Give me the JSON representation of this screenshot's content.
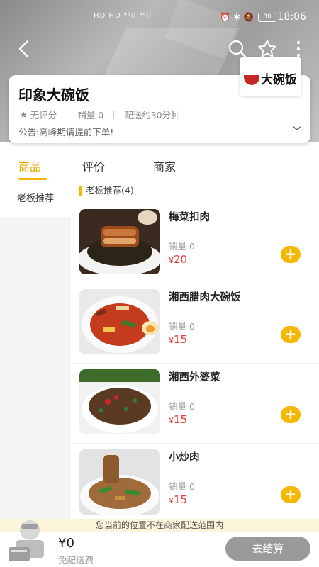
{
  "status_bar": {
    "battery": "80",
    "time": "18:06",
    "network_left": "HD HD ⁴⁶ıl ⁴⁶ıl",
    "icons_right": "⏰ ✱ 🔕"
  },
  "store": {
    "name": "印象大碗饭",
    "rating_text": "无评分",
    "sales_text": "销量 0",
    "delivery_text": "配送约30分钟",
    "notice": "公告:高峰期请提前下单!",
    "logo_text": "大碗饭"
  },
  "tabs": [
    {
      "label": "商品",
      "active": true
    },
    {
      "label": "评价",
      "active": false
    },
    {
      "label": "商家",
      "active": false
    }
  ],
  "sidebar": {
    "items": [
      {
        "label": "老板推荐"
      }
    ]
  },
  "section_title": "老板推荐(4)",
  "products": [
    {
      "name": "梅菜扣肉",
      "sales": "销量 0",
      "currency": "¥",
      "price": "20"
    },
    {
      "name": "湘西腊肉大碗饭",
      "sales": "销量 0",
      "currency": "¥",
      "price": "15"
    },
    {
      "name": "湘西外婆菜",
      "sales": "销量 0",
      "currency": "¥",
      "price": "15"
    },
    {
      "name": "小炒肉",
      "sales": "销量 0",
      "currency": "¥",
      "price": "15"
    }
  ],
  "add_label": "+",
  "cart": {
    "out_of_range_notice": "您当前的位置不在商家配送范围内",
    "total": "¥0",
    "delivery_fee": "免配送费",
    "checkout_label": "去结算"
  },
  "colors": {
    "accent": "#f5b800",
    "price": "#e53935",
    "checkout_disabled": "#9a9a9a"
  }
}
